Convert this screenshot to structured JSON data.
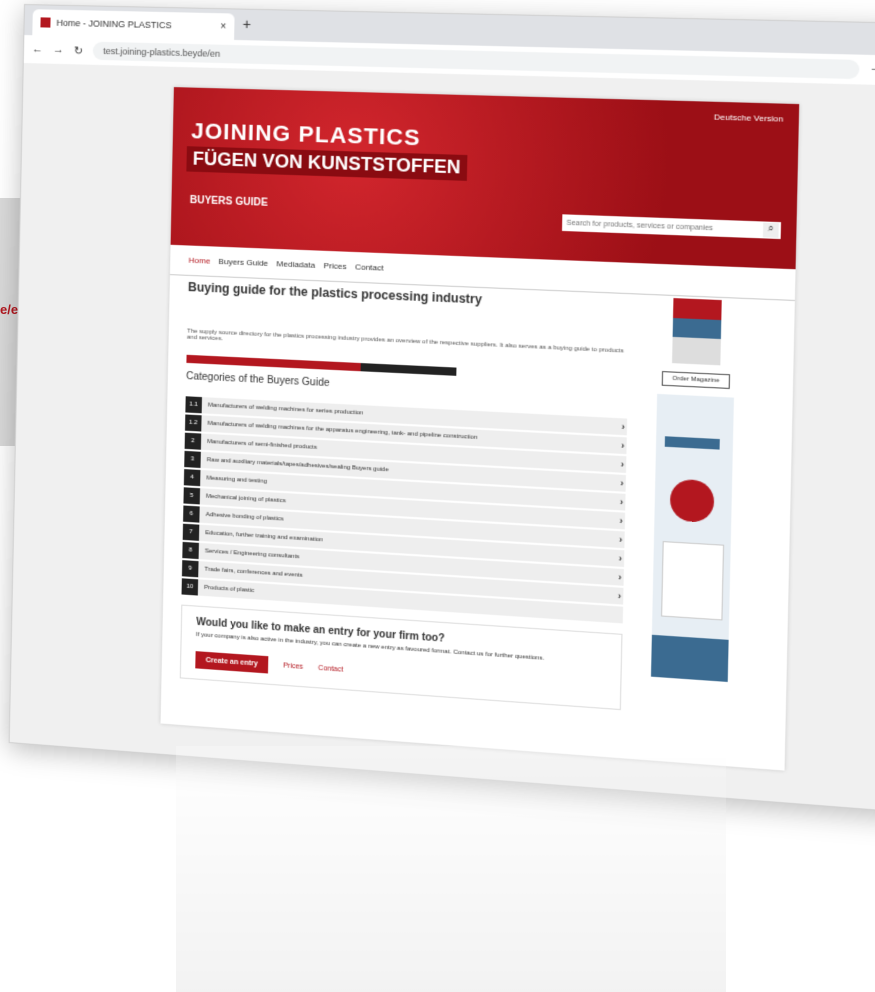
{
  "left_label": "e/en",
  "browser": {
    "tab_title": "Home - JOINING PLASTICS",
    "tab_close": "×",
    "new_tab": "+",
    "url": "test.joining-plastics.beyde/en",
    "minimize": "−",
    "maximize": "□",
    "close": "×"
  },
  "site": {
    "title1": "JOINING PLASTICS",
    "title2": "FÜGEN VON KUNSTSTOFFEN",
    "buyers_guide": "BUYERS GUIDE",
    "lang": "Deutsche Version",
    "search_placeholder": "Search for products, services or companies",
    "nav": [
      "Home",
      "Buyers Guide",
      "Mediadata",
      "Prices",
      "Contact"
    ],
    "heading": "Buying guide for the plastics processing industry",
    "intro": "The supply source directory for the plastics processing industry provides an overview of the respective suppliers. It also serves as a buying guide to products and services.",
    "categories_title": "Categories of the Buyers Guide",
    "categories": [
      {
        "num": "1.1",
        "label": "Manufacturers of welding machines for series production"
      },
      {
        "num": "1.2",
        "label": "Manufacturers of welding machines for the apparatus engineering, tank- and pipeline construction"
      },
      {
        "num": "2",
        "label": "Manufacturers of semi-finished products"
      },
      {
        "num": "3",
        "label": "Raw and auxiliary materials/tapes/adhesives/sealing Buyers guide"
      },
      {
        "num": "4",
        "label": "Measuring and testing"
      },
      {
        "num": "5",
        "label": "Mechanical joining of plastics"
      },
      {
        "num": "6",
        "label": "Adhesive bonding of plastics"
      },
      {
        "num": "7",
        "label": "Education, further training and examination"
      },
      {
        "num": "8",
        "label": "Services / Engineering consultants"
      },
      {
        "num": "9",
        "label": "Trade fairs, conferences and events"
      },
      {
        "num": "10",
        "label": "Products of plastic"
      }
    ],
    "cta_title": "Would you like to make an entry for your firm too?",
    "cta_text": "If your company is also active in the industry, you can create a new entry as favoured format. Contact us for further questions.",
    "cta_button": "Create an entry",
    "cta_link1": "Prices",
    "cta_link2": "Contact",
    "order_button": "Order Magazine"
  }
}
